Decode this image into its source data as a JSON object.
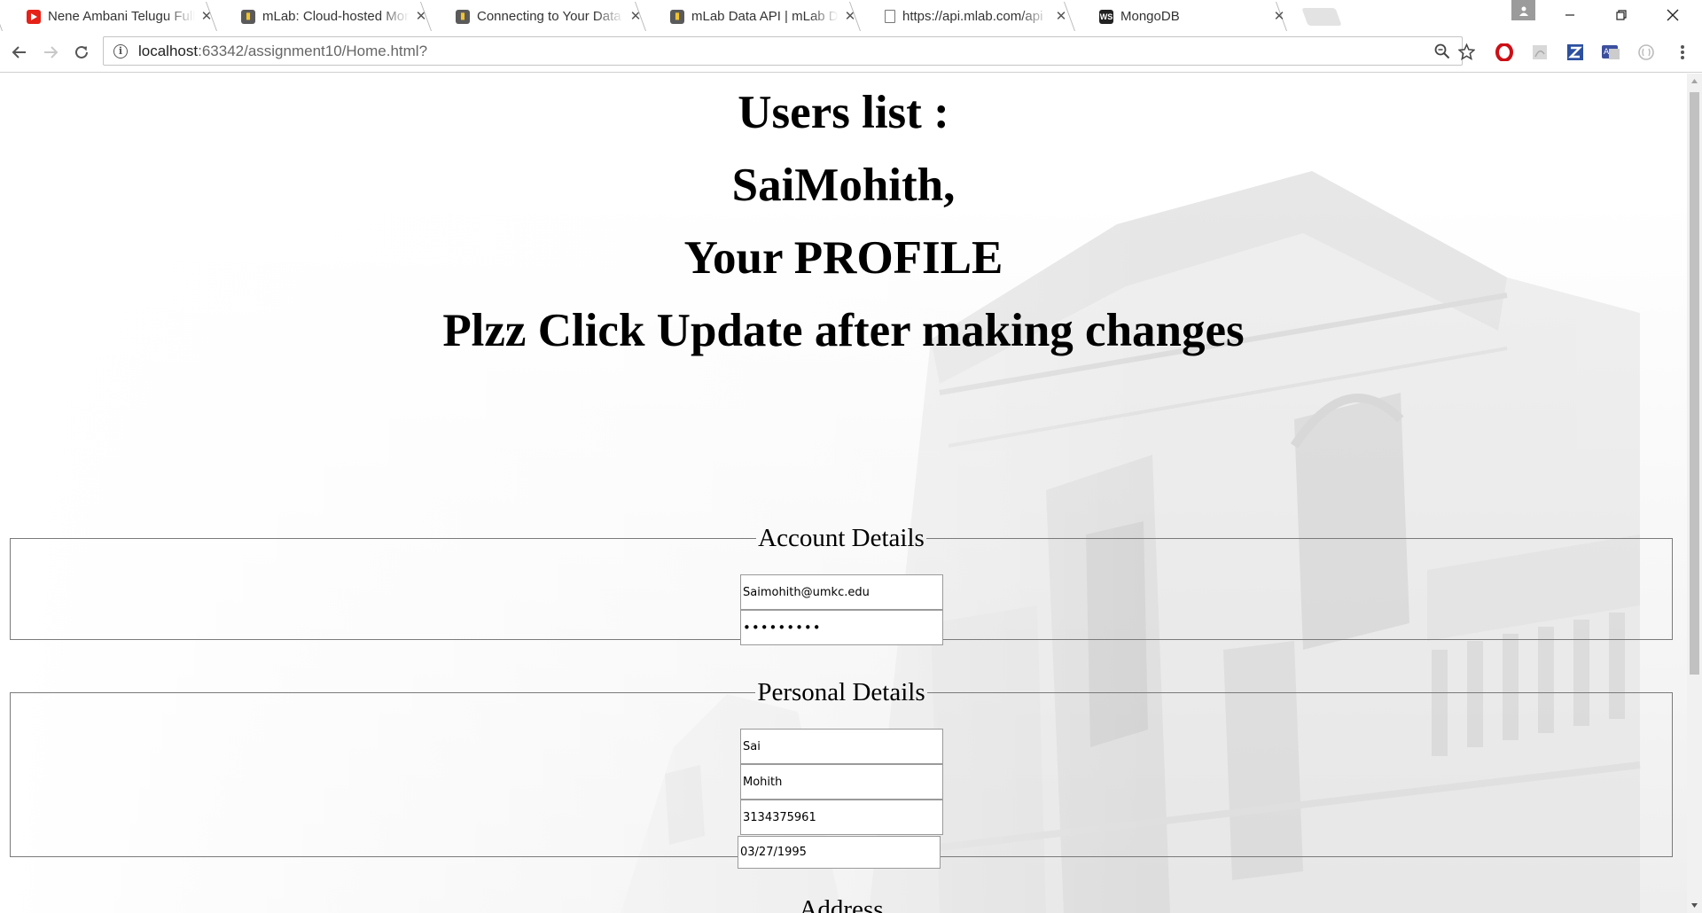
{
  "browser": {
    "tabs": [
      {
        "title": "Nene Ambani Telugu Full",
        "favicon": "youtube-icon"
      },
      {
        "title": "mLab: Cloud-hosted Mon",
        "favicon": "mlab-icon"
      },
      {
        "title": "Connecting to Your Data",
        "favicon": "mlab-icon"
      },
      {
        "title": "mLab Data API | mLab Do",
        "favicon": "mlab-icon"
      },
      {
        "title": "https://api.mlab.com/api",
        "favicon": "document-icon"
      },
      {
        "title": "MongoDB",
        "favicon": "webstorm-icon"
      }
    ],
    "active_tab_index": 5,
    "url_host": "localhost",
    "url_rest": ":63342/assignment10/Home.html?",
    "extensions": [
      "opera-icon",
      "pdf-icon",
      "zotero-icon",
      "translate-icon",
      "disabled-extension-icon"
    ]
  },
  "page": {
    "headings": [
      "Users list :",
      "SaiMohith,",
      "Your PROFILE",
      "Plzz Click Update after making changes"
    ],
    "account": {
      "legend": "Account Details",
      "email": "Saimohith@umkc.edu",
      "password_mask": "•••••••••"
    },
    "personal": {
      "legend": "Personal Details",
      "first_name": "Sai",
      "last_name": "Mohith",
      "phone": "3134375961",
      "dob": "03/27/1995"
    },
    "address": {
      "legend": "Address"
    }
  },
  "colors": {
    "youtube": "#e62117",
    "mlab": "#f0c330",
    "opera": "#cc0f16",
    "zotero": "#2b50a0"
  }
}
